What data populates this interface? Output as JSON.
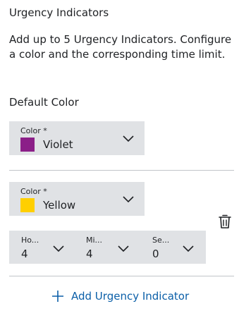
{
  "header": {
    "title": "Urgency Indicators",
    "description": "Add up to 5 Urgency Indicators. Configure a color and the corresponding time limit."
  },
  "default_color": {
    "heading": "Default Color",
    "field_label": "Color *",
    "value": "Violet",
    "swatch_color": "#8b1f88"
  },
  "indicator": {
    "color_field_label": "Color *",
    "color_value": "Yellow",
    "swatch_color": "#ffcf00",
    "hours": {
      "label": "Ho...",
      "value": "4"
    },
    "minutes": {
      "label": "Mi...",
      "value": "4"
    },
    "seconds": {
      "label": "Se...",
      "value": "0"
    },
    "delete_icon": "trash-icon"
  },
  "add_button": {
    "label": "Add Urgency Indicator",
    "icon": "plus-icon",
    "color": "#0b5fa8"
  }
}
